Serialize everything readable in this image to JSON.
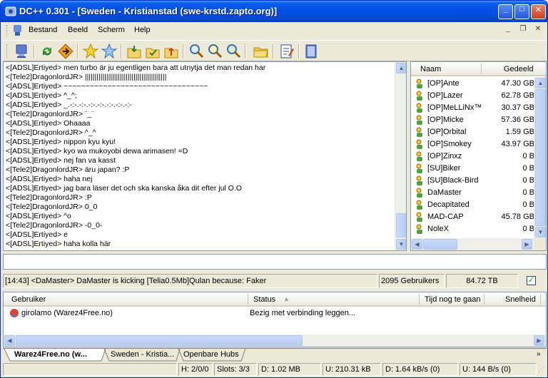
{
  "window": {
    "title": "DC++ 0.301 - [Sweden - Kristianstad (swe-krstd.zapto.org)]"
  },
  "menu": {
    "items": [
      "Bestand",
      "Beeld",
      "Scherm",
      "Help"
    ]
  },
  "chat": {
    "lines": [
      "<[ADSL]Ertiyed> men turbo är ju egentligen bara att utnytja det man redan har",
      "<[Tele2]DragonlordJR> ||||||||||||||||||||||||||||||||||||||||||",
      "<[ADSL]Ertiyed> ~~~~~~~~~~~~~~~~~~~~~~~~~~~~~~~~~",
      "<[ADSL]Ertiyed> ^_^;",
      "<[ADSL]Ertiyed> _.-:-.-:-.-:-.-:-.-:-.-:-.-:-",
      "<[Tele2]DragonlordJR> ¨_¨",
      "<[ADSL]Ertiyed> Ohaaaa",
      "<[Tele2]DragonlordJR> ^_^",
      "<[ADSL]Ertiyed> nippon kyu kyu!",
      "<[ADSL]Ertiyed> kyo wa mukoyobi dewa arimasen! =D",
      "<[ADSL]Ertiyed> nej fan va kasst",
      "<[Tele2]DragonlordJR> äru japan? :P",
      "<[ADSL]Ertiyed> haha nej",
      "<[ADSL]Ertiyed> jag bara läser det och ska kanska åka dit efter jul O.O",
      "<[Tele2]DragonlordJR> :P",
      "<[Tele2]DragonlordJR> 0_0",
      "<[ADSL]Ertiyed> ^o",
      "<[Tele2]DragonlordJR> -0_0-",
      "<[ADSL]Ertiyed> e",
      "<[ADSL]Ertiyed> haha kolla här"
    ]
  },
  "userlist": {
    "col_name": "Naam",
    "col_shared": "Gedeeld",
    "users": [
      {
        "name": "[OP]Ante",
        "size": "47.30 GB"
      },
      {
        "name": "[OP]Lazer",
        "size": "62.78 GB"
      },
      {
        "name": "[OP]MeLLiNx™",
        "size": "30.37 GB"
      },
      {
        "name": "[OP]Micke",
        "size": "57.36 GB"
      },
      {
        "name": "[OP]Orbital",
        "size": "1.59 GB"
      },
      {
        "name": "[OP]Smokey",
        "size": "43.97 GB"
      },
      {
        "name": "[OP]Zinxz",
        "size": "0 B"
      },
      {
        "name": "[SU]Biker",
        "size": "0 B"
      },
      {
        "name": "[SU]Black-Bird",
        "size": "0 B"
      },
      {
        "name": "DaMaster",
        "size": "0 B"
      },
      {
        "name": "Decapitated",
        "size": "0 B"
      },
      {
        "name": "MAD-CAP",
        "size": "45.78 GB"
      },
      {
        "name": "NoleX",
        "size": "0 B"
      }
    ]
  },
  "status": {
    "message": "[14:43] <DaMaster> DaMaster is kicking [Telia0.5Mb]Qulan because: Faker",
    "users": "2095 Gebruikers",
    "shared": "84.72 TB"
  },
  "transfers": {
    "headers": [
      "Gebruiker",
      "Status",
      "Tijd nog te gaan",
      "Snelheid"
    ],
    "rows": [
      {
        "user": "girolamo (Warez4Free.no)",
        "status": "Bezig met verbinding leggen..."
      }
    ]
  },
  "tabs": [
    "Warez4Free.no (w...",
    "Sweden - Kristia...",
    "Openbare Hubs"
  ],
  "statusbar": {
    "h": "H: 2/0/0",
    "slots": "Slots: 3/3",
    "d": "D: 1.02 MB",
    "u": "U: 210.31 kB",
    "dspeed": "D: 1.64 kB/s (0)",
    "uspeed": "U: 144 B/s (0)"
  },
  "colors": {
    "titlebar": "#0054E3",
    "panel": "#ECE9D8",
    "border": "#7F9DB9",
    "op_icon": "#4FA33A"
  }
}
